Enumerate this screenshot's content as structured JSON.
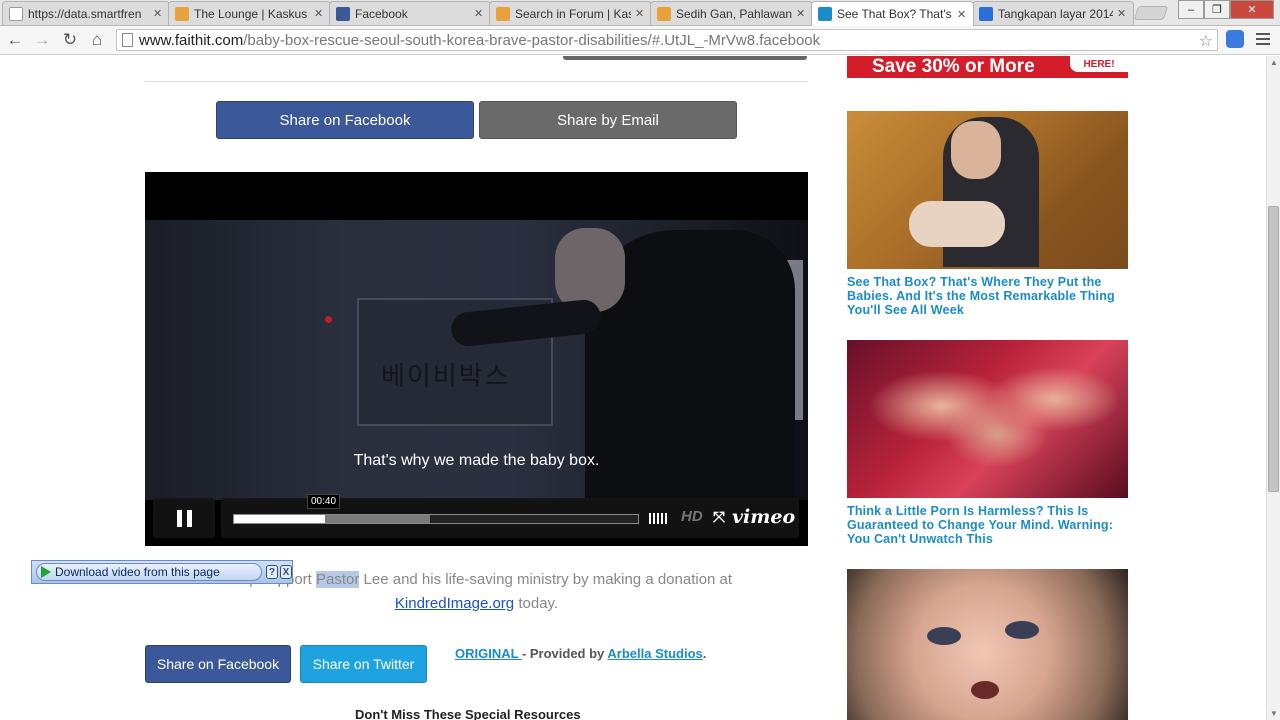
{
  "browser": {
    "tabs": [
      {
        "title": "https://data.smartfren",
        "icon_color": "#eeeeee",
        "active": false
      },
      {
        "title": "The Lounge | Kaskus -",
        "icon_color": "#3aa2e0",
        "active": false
      },
      {
        "title": "Facebook",
        "icon_color": "#3b5998",
        "active": false
      },
      {
        "title": "Search in Forum | Kask",
        "icon_color": "#3aa2e0",
        "active": false
      },
      {
        "title": "Sedih Gan, Pahlawan B",
        "icon_color": "#3aa2e0",
        "active": false
      },
      {
        "title": "See That Box? That's W",
        "icon_color": "#1b8cc8",
        "active": true
      },
      {
        "title": "Tangkapan layar 2014",
        "icon_color": "#2a6fd6",
        "active": false
      }
    ],
    "url_host": "www.faithit.com",
    "url_path": "/baby-box-rescue-seoul-south-korea-brave-pastor-disabilities/#.UtJL_-MrVw8.facebook"
  },
  "article": {
    "share_facebook_top": "Share on Facebook",
    "share_email_top": "Share by Email",
    "video": {
      "subtitle": "That's why we made the baby box.",
      "korean_text": "베이비박스",
      "current_time": "00:40",
      "progress_played": 0.225,
      "progress_loaded": 0.485,
      "hd_label": "HD",
      "brand": "vimeo"
    },
    "donate_prefix": "*Help support ",
    "donate_highlight": "Pastor",
    "donate_middle": " Lee and his life-saving ministry by making a donation at",
    "donate_link": "KindredImage.org",
    "donate_suffix": " today.",
    "share_facebook": "Share on Facebook",
    "share_twitter": "Share on Twitter",
    "credit_link": "ORIGINAL ",
    "credit_text": " - Provided by ",
    "credit_studio": "Arbella Studios",
    "credit_end": ".",
    "resources_heading": "Don't Miss These Special Resources"
  },
  "download_bar": {
    "label": "Download video from this page",
    "help": "?",
    "close": "X"
  },
  "sidebar": {
    "banner_text": "Save 30% or More",
    "banner_tag": "HERE!",
    "items": [
      {
        "caption": "See That Box? That's Where They Put the Babies. And It's the Most Remarkable Thing You'll See All Week"
      },
      {
        "caption": "Think a Little Porn Is Harmless? This Is Guaranteed to Change Your Mind. Warning: You Can't Unwatch This"
      }
    ]
  }
}
